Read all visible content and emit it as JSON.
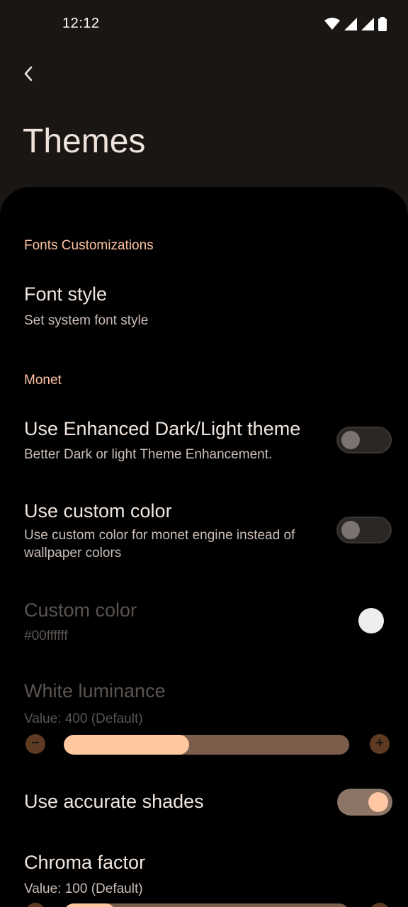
{
  "status_bar": {
    "time": "12:12",
    "icons": [
      "wifi-icon",
      "signal-icon",
      "signal-icon",
      "battery-icon"
    ]
  },
  "app_bar": {
    "back_icon": "back-arrow-icon",
    "title": "Themes"
  },
  "sections": {
    "fonts": {
      "header": "Fonts Customizations",
      "font_style": {
        "title": "Font style",
        "summary": "Set system font style"
      }
    },
    "monet": {
      "header": "Monet",
      "enhanced_theme": {
        "title": "Use Enhanced Dark/Light theme",
        "summary": "Better Dark or light Theme Enhancement.",
        "enabled": false
      },
      "custom_color_toggle": {
        "title": "Use custom color",
        "summary_line1": "Use custom color for monet engine instead of",
        "summary_line2": "wallpaper colors",
        "enabled": false
      },
      "custom_color": {
        "title": "Custom color",
        "summary": "#00ffffff",
        "swatch_color": "#eeeeee",
        "disabled": true
      },
      "white_luminance": {
        "title": "White luminance",
        "summary": "Value: 400 (Default)",
        "fill_fraction": 0.44,
        "disabled": true
      },
      "accurate_shades": {
        "title": "Use accurate shades",
        "enabled": true
      },
      "chroma_factor": {
        "title": "Chroma factor",
        "summary": "Value: 100 (Default)"
      }
    }
  },
  "colors": {
    "accent": "#ffc3a1",
    "background": "#000000",
    "app_bar_background": "#1a1614"
  }
}
